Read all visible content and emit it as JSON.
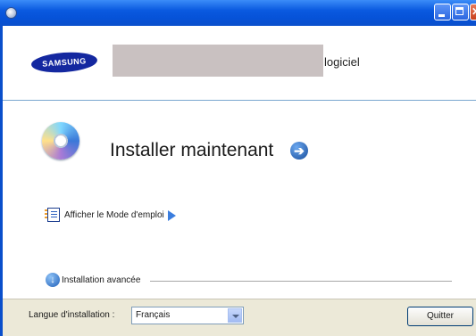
{
  "header": {
    "brand": "SAMSUNG",
    "product_suffix": "logiciel"
  },
  "main": {
    "install_now_label": "Installer maintenant",
    "manual_link_label": "Afficher le Mode d'emploi",
    "advanced_label": "Installation avancée"
  },
  "footer": {
    "language_label": "Langue d'installation :",
    "language_selected": "Français",
    "quit_label": "Quitter"
  },
  "icons": {
    "window_icon": "cd-icon",
    "install_icon": "cd-disc-icon",
    "install_go": "arrow-right-circle-icon",
    "manual_icon": "notebook-icon",
    "manual_go": "play-triangle-icon",
    "advanced_icon": "arrow-down-circle-icon"
  },
  "colors": {
    "titlebar": "#0a5ae0",
    "brand": "#1428a0",
    "link_arrow": "#3a7dde",
    "footer_bg": "#ece9d8"
  }
}
